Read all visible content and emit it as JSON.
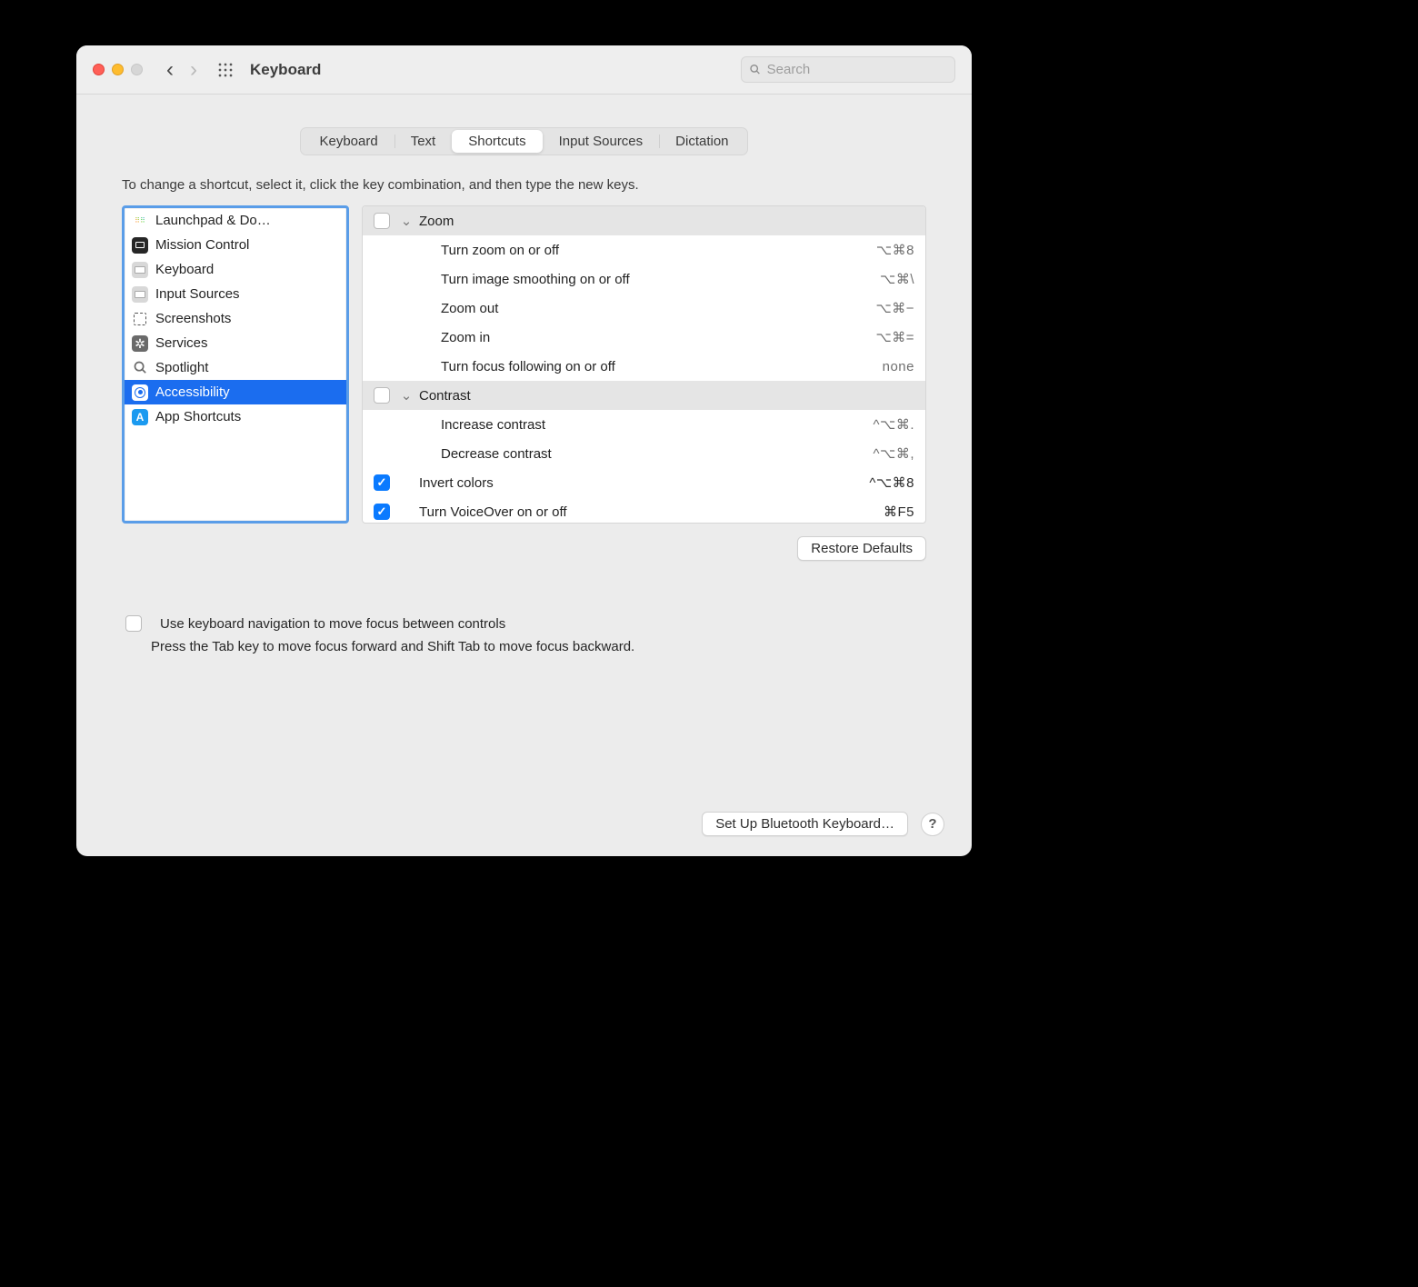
{
  "window_title": "Keyboard",
  "search": {
    "placeholder": "Search"
  },
  "tabs": {
    "items": [
      "Keyboard",
      "Text",
      "Shortcuts",
      "Input Sources",
      "Dictation"
    ],
    "active_index": 2
  },
  "hint": "To change a shortcut, select it, click the key combination, and then type the new keys.",
  "categories": [
    {
      "label": "Launchpad & Dock",
      "icon": "launchpad",
      "truncated": "Launchpad & Do…"
    },
    {
      "label": "Mission Control",
      "icon": "missioncontrol"
    },
    {
      "label": "Keyboard",
      "icon": "keyboard"
    },
    {
      "label": "Input Sources",
      "icon": "keyboard"
    },
    {
      "label": "Screenshots",
      "icon": "screenshots"
    },
    {
      "label": "Services",
      "icon": "services"
    },
    {
      "label": "Spotlight",
      "icon": "spotlight"
    },
    {
      "label": "Accessibility",
      "icon": "accessibility",
      "selected": true
    },
    {
      "label": "App Shortcuts",
      "icon": "appshortcuts"
    }
  ],
  "shortcuts": [
    {
      "type": "group",
      "label": "Zoom",
      "checked": false
    },
    {
      "type": "item",
      "label": "Turn zoom on or off",
      "key": "⌥⌘8"
    },
    {
      "type": "item",
      "label": "Turn image smoothing on or off",
      "key": "⌥⌘\\"
    },
    {
      "type": "item",
      "label": "Zoom out",
      "key": "⌥⌘−"
    },
    {
      "type": "item",
      "label": "Zoom in",
      "key": "⌥⌘="
    },
    {
      "type": "item",
      "label": "Turn focus following on or off",
      "key": "none"
    },
    {
      "type": "group",
      "label": "Contrast",
      "checked": false
    },
    {
      "type": "item",
      "label": "Increase contrast",
      "key": "^⌥⌘."
    },
    {
      "type": "item",
      "label": "Decrease contrast",
      "key": "^⌥⌘,"
    },
    {
      "type": "single",
      "label": "Invert colors",
      "key": "^⌥⌘8",
      "checked": true,
      "strong": true
    },
    {
      "type": "single",
      "label": "Turn VoiceOver on or off",
      "key": "⌘F5",
      "checked": true,
      "strong": true
    }
  ],
  "restore_defaults": "Restore Defaults",
  "nav_focus": {
    "checkbox_label": "Use keyboard navigation to move focus between controls",
    "hint": "Press the Tab key to move focus forward and Shift Tab to move focus backward."
  },
  "bluetooth_button": "Set Up Bluetooth Keyboard…",
  "help": "?"
}
